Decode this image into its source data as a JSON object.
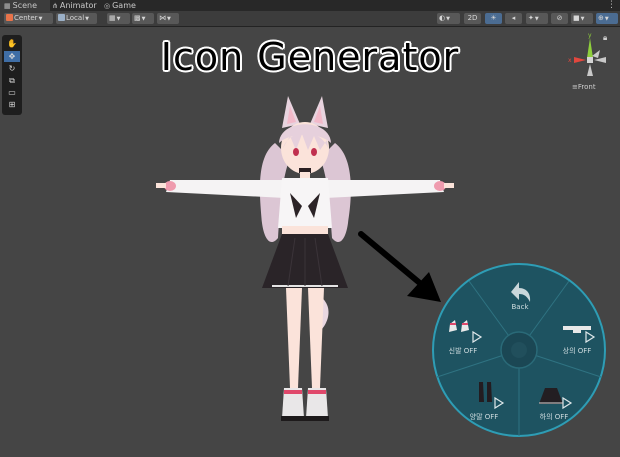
{
  "tabs": [
    {
      "label": "Scene",
      "icon": "grid-icon",
      "active": true
    },
    {
      "label": "Animator",
      "icon": "animator-icon",
      "active": false
    },
    {
      "label": "Game",
      "icon": "gamepad-icon",
      "active": false
    }
  ],
  "toolbar": {
    "pivot_label": "Center",
    "space_label": "Local",
    "mode_2d_label": "2D"
  },
  "title": "Icon Generator",
  "gizmo": {
    "axis_x": "x",
    "axis_y": "y",
    "view_label": "Front"
  },
  "radial_menu": {
    "back_label": "Back",
    "items": [
      {
        "label": "신발 OFF",
        "icon": "shoes-icon"
      },
      {
        "label": "상의 OFF",
        "icon": "shirt-icon"
      },
      {
        "label": "양말 OFF",
        "icon": "socks-icon"
      },
      {
        "label": "하의 OFF",
        "icon": "skirt-icon"
      }
    ]
  },
  "colors": {
    "scene_background": "#454545",
    "radial_fill": "#1e5361",
    "radial_border": "#2e9db5",
    "highlight": "#4b6c92"
  }
}
